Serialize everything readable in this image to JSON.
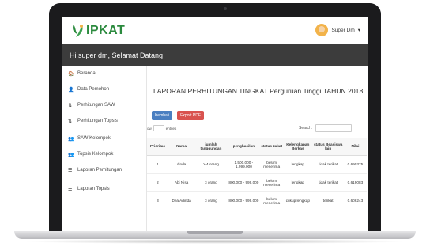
{
  "app": {
    "logo_text": "IPKAT",
    "user_name": "Super Dm",
    "welcome": "Hi super dm, Selamat Datang"
  },
  "sidebar": {
    "items": [
      {
        "label": "Beranda",
        "icon": "home-icon",
        "glyph": "🏠"
      },
      {
        "label": "Data Pemohon",
        "icon": "user-icon",
        "glyph": "👤"
      },
      {
        "label": "Perhitungan SAW",
        "icon": "sort-icon",
        "glyph": "⇅"
      },
      {
        "label": "Perhitungan Topsis",
        "icon": "sort-icon",
        "glyph": "⇅"
      },
      {
        "label": "SAW Kelompok",
        "icon": "group-icon",
        "glyph": "👥"
      },
      {
        "label": "Topsis Kelompok",
        "icon": "group-icon",
        "glyph": "👥"
      },
      {
        "label": "Laporan Perhitungan",
        "icon": "list-icon",
        "glyph": "☰"
      },
      {
        "label": "Laporan Topsis",
        "icon": "list-icon",
        "glyph": "☰"
      }
    ]
  },
  "main": {
    "title": "LAPORAN PERHITUNGAN TINGKAT Perguruan Tinggi TAHUN 2018",
    "back_label": "Kembali",
    "export_label": "Export PDF",
    "show_label": "ow",
    "entries_label": "entries",
    "search_label": "Search:"
  },
  "table": {
    "headers": [
      "Prioritas",
      "Nama",
      "jumlah tanggungan",
      "penghasilan",
      "status zakat",
      "Kelengkapan Berkas",
      "status Beasiswa lain",
      "Nilai"
    ],
    "rows": [
      [
        "1",
        "dinda",
        "> 4 orang",
        "1.500.000 - 1.999.000",
        "belum menerima",
        "lengkap",
        "tidak terikat",
        "0.690375"
      ],
      [
        "2",
        "Abi Nisa",
        "3 orang",
        "800.000 - 999.000",
        "belum menerima",
        "lengkap",
        "tidak terikat",
        "0.619083"
      ],
      [
        "3",
        "Dea Adinda",
        "3 orang",
        "800.000 - 999.000",
        "belum menerima",
        "cukup lengkap",
        "terikat",
        "0.606243"
      ]
    ]
  },
  "colors": {
    "logo": "#2b8a3e",
    "welcome_bar": "#3c3c3c",
    "btn_back": "#4a7fc1",
    "btn_export": "#d9534f"
  }
}
